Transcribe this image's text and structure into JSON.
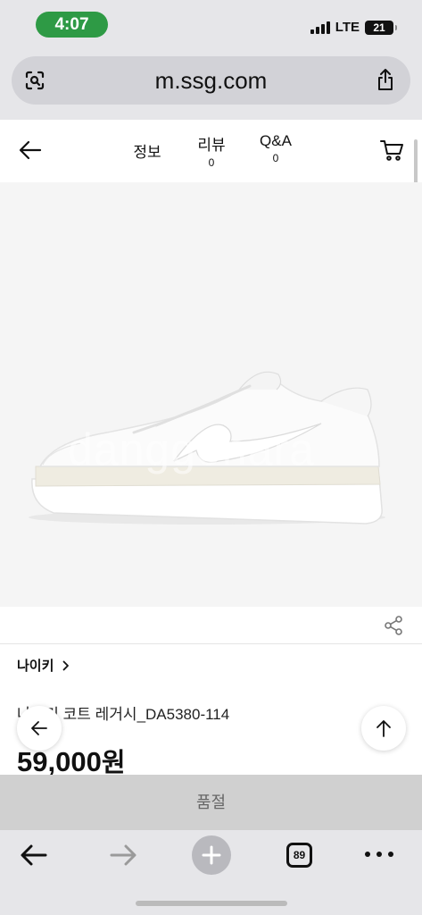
{
  "status_bar": {
    "time": "4:07",
    "network": "LTE",
    "battery": "21"
  },
  "browser": {
    "url": "m.ssg.com",
    "tab_count": "89"
  },
  "nav": {
    "tabs": [
      {
        "label": "정보",
        "count": ""
      },
      {
        "label": "리뷰",
        "count": "0"
      },
      {
        "label": "Q&A",
        "count": "0"
      }
    ]
  },
  "product": {
    "image_watermark": "danggonara",
    "brand": "나이키",
    "title": "나이키 코트 레거시_DA5380-114",
    "price": "59,000",
    "price_unit": "원",
    "sold_out_label": "품절"
  }
}
